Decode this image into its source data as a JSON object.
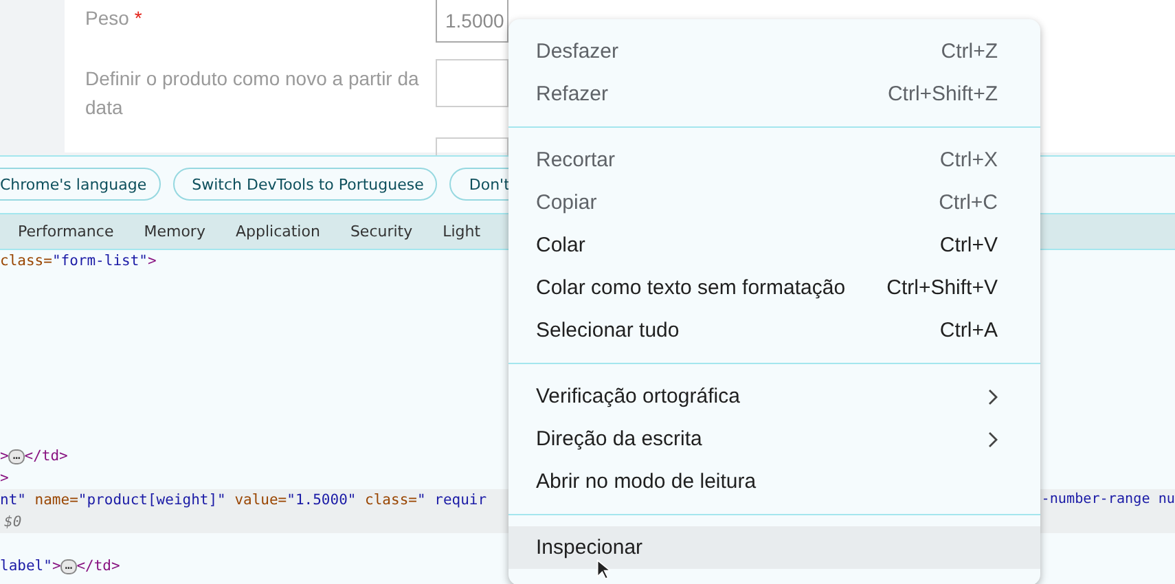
{
  "form": {
    "fields": [
      {
        "label": "Peso",
        "required_mark": "*",
        "value": "1.5000",
        "focused": true
      },
      {
        "label": "Definir o produto como novo a partir da data",
        "focused": false
      },
      {
        "focused": false
      }
    ]
  },
  "devtools": {
    "infobar": {
      "buttons": [
        "Chrome's language",
        "Switch DevTools to Portuguese",
        "Don't"
      ]
    },
    "tabs": [
      {
        "label": "Performance",
        "selected": false
      },
      {
        "label": "Memory",
        "selected": false
      },
      {
        "label": "Application",
        "selected": false
      },
      {
        "label": "Security",
        "selected": false
      },
      {
        "label": "Light",
        "selected": false
      }
    ],
    "code": [
      {
        "selected": false,
        "tokens": [
          {
            "text": "class=",
            "kind": "attr"
          },
          {
            "text": "\"form-list\"",
            "kind": "value"
          },
          {
            "text": ">",
            "kind": "tag"
          }
        ]
      },
      {
        "selected": false,
        "tokens": [
          {
            "text": ">",
            "kind": "tag"
          },
          {
            "text": "…",
            "kind": "ellipsis"
          },
          {
            "text": "</td>",
            "kind": "tag"
          }
        ]
      },
      {
        "selected": false,
        "tokens": [
          {
            "text": ">",
            "kind": "tag"
          }
        ]
      },
      {
        "selected": true,
        "tokens": [
          {
            "text": "nt\"",
            "kind": "value"
          },
          {
            "text": " name=",
            "kind": "attr"
          },
          {
            "text": "\"product[weight]\"",
            "kind": "value"
          },
          {
            "text": " value=",
            "kind": "attr"
          },
          {
            "text": "\"1.5000\"",
            "kind": "value"
          },
          {
            "text": " class=",
            "kind": "attr"
          },
          {
            "text": "\" requir",
            "kind": "value"
          }
        ],
        "tail": [
          {
            "text": "-number-range nu",
            "kind": "value"
          }
        ],
        "note": "$0"
      },
      {
        "selected": false,
        "tokens": [
          {
            "text": "label\"",
            "kind": "value"
          },
          {
            "text": ">",
            "kind": "tag"
          },
          {
            "text": "…",
            "kind": "ellipsis"
          },
          {
            "text": "</td>",
            "kind": "tag"
          }
        ]
      }
    ]
  },
  "context_menu": {
    "groups": [
      [
        {
          "kind": "command",
          "label": "Desfazer",
          "shortcut": "Ctrl+Z",
          "disabled": true,
          "selected": false
        },
        {
          "kind": "command",
          "label": "Refazer",
          "shortcut": "Ctrl+Shift+Z",
          "disabled": true,
          "selected": false
        }
      ],
      [
        {
          "kind": "command",
          "label": "Recortar",
          "shortcut": "Ctrl+X",
          "disabled": true,
          "selected": false
        },
        {
          "kind": "command",
          "label": "Copiar",
          "shortcut": "Ctrl+C",
          "disabled": true,
          "selected": false
        },
        {
          "kind": "command",
          "label": "Colar",
          "shortcut": "Ctrl+V",
          "disabled": false,
          "selected": false
        },
        {
          "kind": "command",
          "label": "Colar como texto sem formatação",
          "shortcut": "Ctrl+Shift+V",
          "disabled": false,
          "selected": false
        },
        {
          "kind": "command",
          "label": "Selecionar tudo",
          "shortcut": "Ctrl+A",
          "disabled": false,
          "selected": false
        }
      ],
      [
        {
          "kind": "submenu",
          "label": "Verificação ortográfica",
          "disabled": false,
          "selected": false
        },
        {
          "kind": "submenu",
          "label": "Direção da escrita",
          "disabled": false,
          "selected": false
        },
        {
          "kind": "command",
          "label": "Abrir no modo de leitura",
          "disabled": false,
          "selected": false
        }
      ],
      [
        {
          "kind": "command",
          "label": "Inspecionar",
          "disabled": false,
          "selected": true
        }
      ]
    ]
  }
}
